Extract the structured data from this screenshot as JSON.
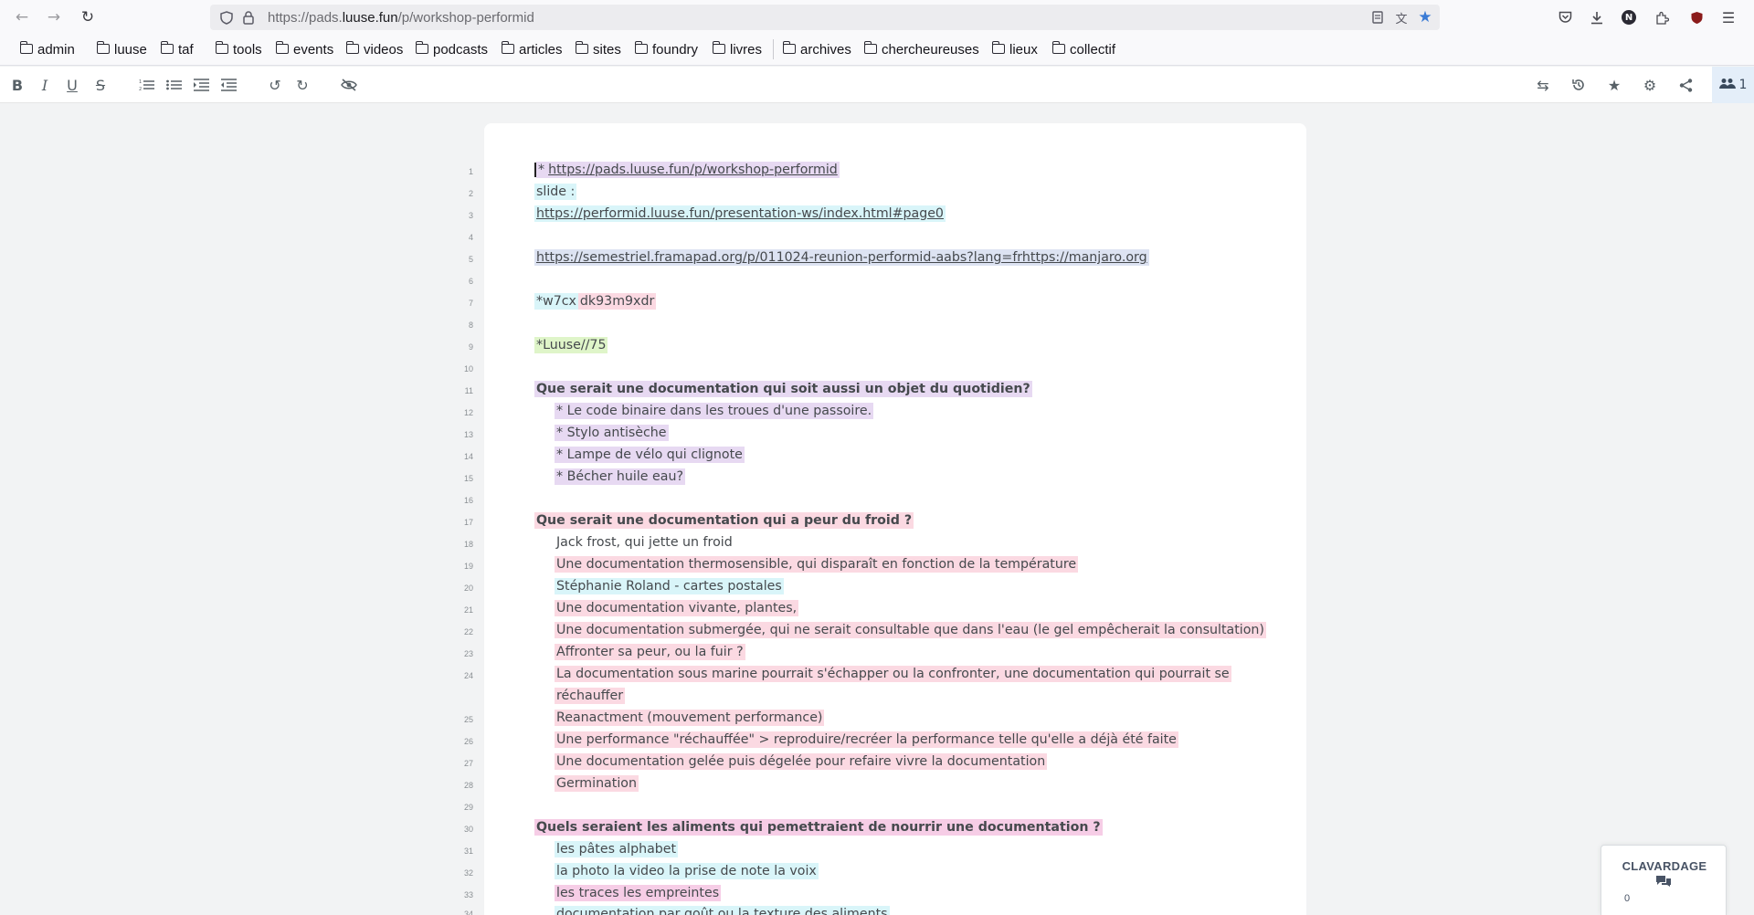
{
  "browser": {
    "url_prefix": "https://pads.",
    "url_domain": "luuse.fun",
    "url_suffix": "/p/workshop-performid",
    "profile_initial": "N"
  },
  "bookmarks": [
    {
      "label": "admin"
    },
    {
      "label": "luuse"
    },
    {
      "label": "taf"
    },
    {
      "label": "tools"
    },
    {
      "label": "events"
    },
    {
      "label": "videos"
    },
    {
      "label": "podcasts"
    },
    {
      "label": "articles"
    },
    {
      "label": "sites"
    },
    {
      "label": "foundry"
    },
    {
      "label": "livres"
    },
    {
      "label": "archives"
    },
    {
      "label": "chercheureuses"
    },
    {
      "label": "lieux"
    },
    {
      "label": "collectif"
    }
  ],
  "toolbar": {
    "users_count": "1"
  },
  "editor": {
    "lines": [
      {
        "n": "1",
        "text": "https://pads.luuse.fun/p/workshop-performid",
        "prefix": "*"
      },
      {
        "n": "2",
        "text": "slide :"
      },
      {
        "n": "3",
        "text": "https://performid.luuse.fun/presentation-ws/index.html#page0"
      },
      {
        "n": "4",
        "text": ""
      },
      {
        "n": "5",
        "text": "https://semestriel.framapad.org/p/011024-reunion-performid-aabs?lang=frhttps://manjaro.org"
      },
      {
        "n": "6",
        "text": ""
      },
      {
        "n": "7",
        "text_a": "*w7cx",
        "text_b": "dk93m9xdr"
      },
      {
        "n": "8",
        "text": ""
      },
      {
        "n": "9",
        "text": "*Luuse//75"
      },
      {
        "n": "10",
        "text": ""
      },
      {
        "n": "11",
        "text": "Que serait une documentation qui soit aussi un objet du quotidien?"
      },
      {
        "n": "12",
        "text": "* Le code binaire dans les troues d'une passoire."
      },
      {
        "n": "13",
        "text": "* Stylo antisèche"
      },
      {
        "n": "14",
        "text": "* Lampe de vélo qui clignote"
      },
      {
        "n": "15",
        "text": "* Bécher huile eau?"
      },
      {
        "n": "16",
        "text": ""
      },
      {
        "n": "17",
        "text": "Que serait une documentation qui a peur du froid ?"
      },
      {
        "n": "18",
        "text": "Jack frost, qui jette un froid"
      },
      {
        "n": "19",
        "text": "Une documentation thermosensible, qui disparaît en fonction de la température"
      },
      {
        "n": "20",
        "text": "Stéphanie Roland - cartes postales"
      },
      {
        "n": "21",
        "text": "Une documentation vivante, plantes,"
      },
      {
        "n": "22",
        "text": "Une documentation submergée, qui ne serait consultable que dans l'eau (le gel empêcherait la consultation)"
      },
      {
        "n": "23",
        "text": "Affronter sa peur, ou la fuir ?"
      },
      {
        "n": "24",
        "text": "La documentation sous marine pourrait s'échapper ou la confronter, une documentation qui pourrait se",
        "text_cont": "réchauffer"
      },
      {
        "n": "25",
        "text": "Reanactment (mouvement performance)"
      },
      {
        "n": "26",
        "text": "Une performance \"réchauffée\" > reproduire/recréer la performance telle qu'elle a déjà été faite"
      },
      {
        "n": "27",
        "text": "Une documentation gelée puis dégelée pour refaire vivre la documentation"
      },
      {
        "n": "28",
        "text": "Germination"
      },
      {
        "n": "29",
        "text": ""
      },
      {
        "n": "30",
        "text": "Quels seraient les aliments qui pemettraient de nourrir une documentation ?"
      },
      {
        "n": "31",
        "text": "les pâtes alphabet"
      },
      {
        "n": "32",
        "text": "la photo la video la prise de note la voix"
      },
      {
        "n": "33",
        "text": "les traces les empreintes"
      },
      {
        "n": "34",
        "text": "documentation par goût ou la texture des aliments"
      }
    ]
  },
  "chat": {
    "title": "CLAVARDAGE",
    "count": "0"
  }
}
